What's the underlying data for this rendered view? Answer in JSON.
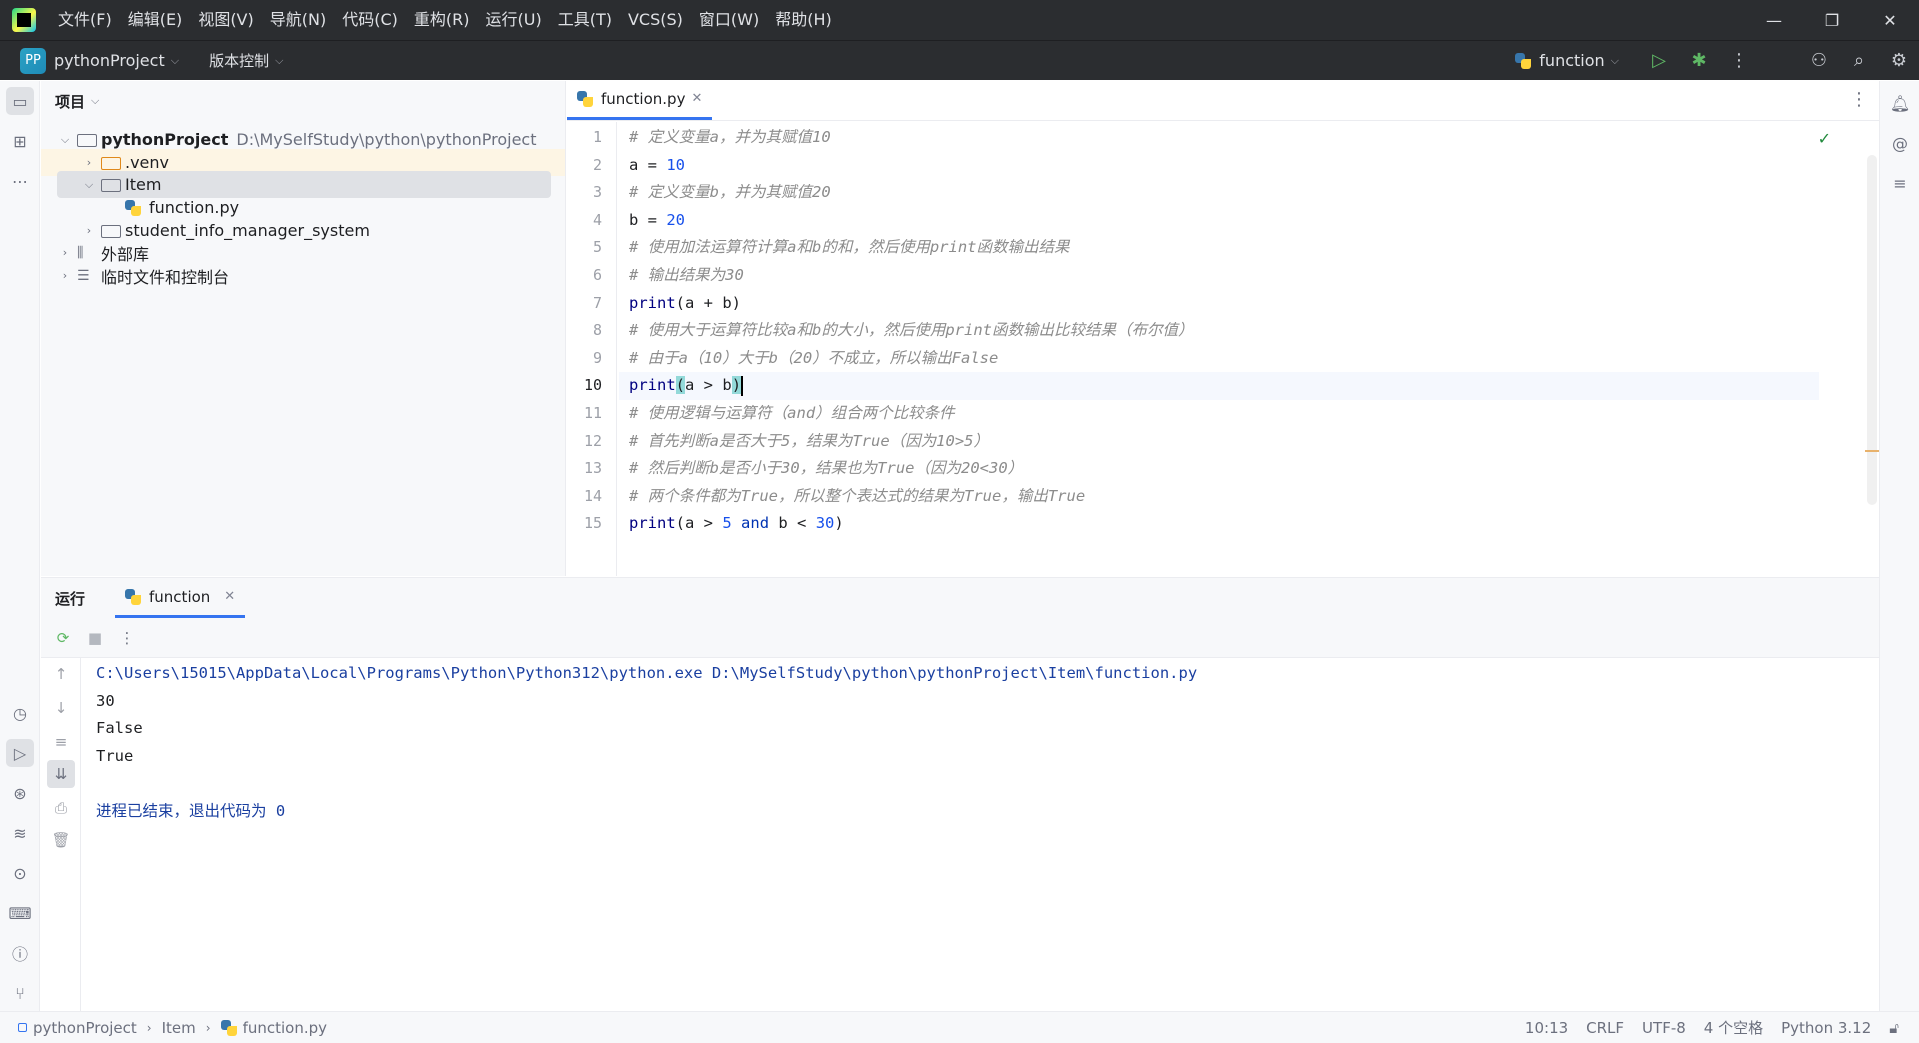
{
  "menu": [
    "文件(F)",
    "编辑(E)",
    "视图(V)",
    "导航(N)",
    "代码(C)",
    "重构(R)",
    "运行(U)",
    "工具(T)",
    "VCS(S)",
    "窗口(W)",
    "帮助(H)"
  ],
  "toolbar": {
    "project_badge": "PP",
    "project_name": "pythonProject",
    "vcs_label": "版本控制",
    "run_config": "function"
  },
  "project_panel": {
    "title": "项目",
    "root_name": "pythonProject",
    "root_path": "D:\\MySelfStudy\\python\\pythonProject",
    "venv": ".venv",
    "item_folder": "Item",
    "file": "function.py",
    "student_folder": "student_info_manager_system",
    "external_libs": "外部库",
    "scratches": "临时文件和控制台"
  },
  "editor": {
    "tab_label": "function.py",
    "current_line": 10,
    "lines": [
      "# 定义变量a，并为其赋值10",
      "a = 10",
      "# 定义变量b，并为其赋值20",
      "b = 20",
      "# 使用加法运算符计算a和b的和，然后使用print函数输出结果",
      "# 输出结果为30",
      "print(a + b)",
      "# 使用大于运算符比较a和b的大小，然后使用print函数输出比较结果（布尔值）",
      "# 由于a（10）大于b（20）不成立，所以输出False",
      "print(a > b)",
      "# 使用逻辑与运算符（and）组合两个比较条件",
      "# 首先判断a是否大于5，结果为True（因为10>5）",
      "# 然后判断b是否小于30，结果也为True（因为20<30）",
      "# 两个条件都为True，所以整个表达式的结果为True，输出True",
      "print(a > 5 and b < 30)"
    ]
  },
  "run_panel": {
    "title": "运行",
    "tab_label": "function",
    "command": "C:\\Users\\15015\\AppData\\Local\\Programs\\Python\\Python312\\python.exe D:\\MySelfStudy\\python\\pythonProject\\Item\\function.py",
    "output": [
      "30",
      "False",
      "True"
    ],
    "exit_message": "进程已结束，退出代码为 0"
  },
  "statusbar": {
    "crumbs": [
      "pythonProject",
      "Item",
      "function.py"
    ],
    "position": "10:13",
    "line_sep": "CRLF",
    "encoding": "UTF-8",
    "indent": "4 个空格",
    "interpreter": "Python 3.12"
  }
}
